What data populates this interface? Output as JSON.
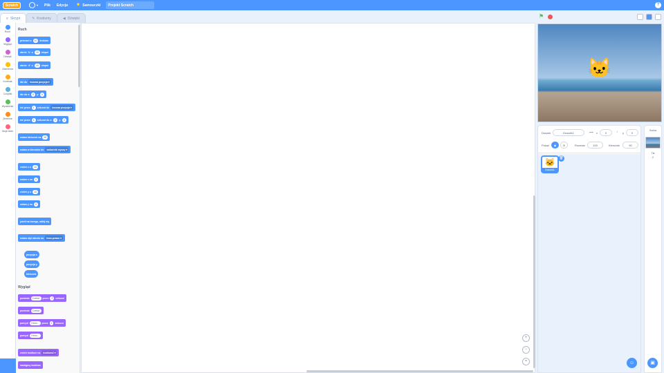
{
  "topbar": {
    "logo": "Scratch",
    "menu_file": "Plik",
    "menu_edit": "Edycja",
    "menu_tutorials": "Samouczki",
    "project_title": "Projekt Scratch",
    "help": "?"
  },
  "tabs": {
    "code": "Skrypt",
    "costumes": "Kostiumy",
    "sounds": "Dźwięki"
  },
  "categories": [
    {
      "label": "Ruch",
      "color": "#4c97ff"
    },
    {
      "label": "Wygląd",
      "color": "#9966ff"
    },
    {
      "label": "Dźwięk",
      "color": "#cf63cf"
    },
    {
      "label": "Zdarzenia",
      "color": "#ffbf00"
    },
    {
      "label": "Kontrola",
      "color": "#ffab19"
    },
    {
      "label": "Czujniki",
      "color": "#5cb1d6"
    },
    {
      "label": "Wyrażenia",
      "color": "#59c059"
    },
    {
      "label": "Zmienne",
      "color": "#ff8c1a"
    },
    {
      "label": "Moje bloki",
      "color": "#ff6680"
    }
  ],
  "palette": {
    "motion_title": "Ruch",
    "looks_title": "Wygląd",
    "move": {
      "a": "przesuń o",
      "v": "10",
      "b": "kroków"
    },
    "turn_right": {
      "a": "obróć",
      "b": "o",
      "v": "15",
      "c": "stopni"
    },
    "turn_left": {
      "a": "obróć",
      "b": "o",
      "v": "15",
      "c": "stopni"
    },
    "goto": {
      "a": "idź do",
      "d": "losowa pozycja"
    },
    "gotoxy": {
      "a": "idź do x:",
      "x": "0",
      "b": "y:",
      "y": "0"
    },
    "glide_to": {
      "a": "leć przez",
      "v": "1",
      "b": "sekund do",
      "d": "losowa pozycja"
    },
    "glide_xy": {
      "a": "leć przez",
      "v": "1",
      "b": "sekund do x:",
      "x": "0",
      "c": "y:",
      "y": "0"
    },
    "point_dir": {
      "a": "ustaw kierunek na",
      "v": "90"
    },
    "point_towards": {
      "a": "ustaw w kierunku do",
      "d": "wskaźnik myszy"
    },
    "change_x": {
      "a": "zmień x o",
      "v": "10"
    },
    "set_x": {
      "a": "ustaw x na",
      "v": "0"
    },
    "change_y": {
      "a": "zmień y o",
      "v": "10"
    },
    "set_y": {
      "a": "ustaw y na",
      "v": "0"
    },
    "bounce": "jeżeli na brzegu, odbij się",
    "rotation": {
      "a": "ustaw styl obrotu na",
      "d": "lewo-prawo"
    },
    "rep_x": "pozycja x",
    "rep_y": "pozycja y",
    "rep_dir": "kierunek",
    "say_for": {
      "a": "powiedz",
      "t": "Cześć!",
      "b": "przez",
      "v": "2",
      "c": "sekund"
    },
    "say": {
      "a": "powiedz",
      "t": "Cześć!"
    },
    "think_for": {
      "a": "pomyśl",
      "t": "Hmm...",
      "b": "przez",
      "v": "2",
      "c": "sekund"
    },
    "think": {
      "a": "pomyśl",
      "t": "Hmm..."
    },
    "switch_costume": {
      "a": "zmień kostium na",
      "d": "kostium2"
    },
    "next_costume": "następny kostium"
  },
  "sprite_info": {
    "sprite_label": "Duszek",
    "sprite_name": "Duszek1",
    "x_label": "x",
    "x_value": "0",
    "y_label": "y",
    "y_value": "0",
    "show_label": "Pokaż",
    "size_label": "Rozmiar",
    "size_value": "100",
    "direction_label": "Kierunek",
    "direction_value": "90"
  },
  "sprites": [
    {
      "name": "Duszek1"
    }
  ],
  "stage_panel": {
    "title": "Scena",
    "backdrops_label": "Tła",
    "backdrops_count": "2"
  }
}
